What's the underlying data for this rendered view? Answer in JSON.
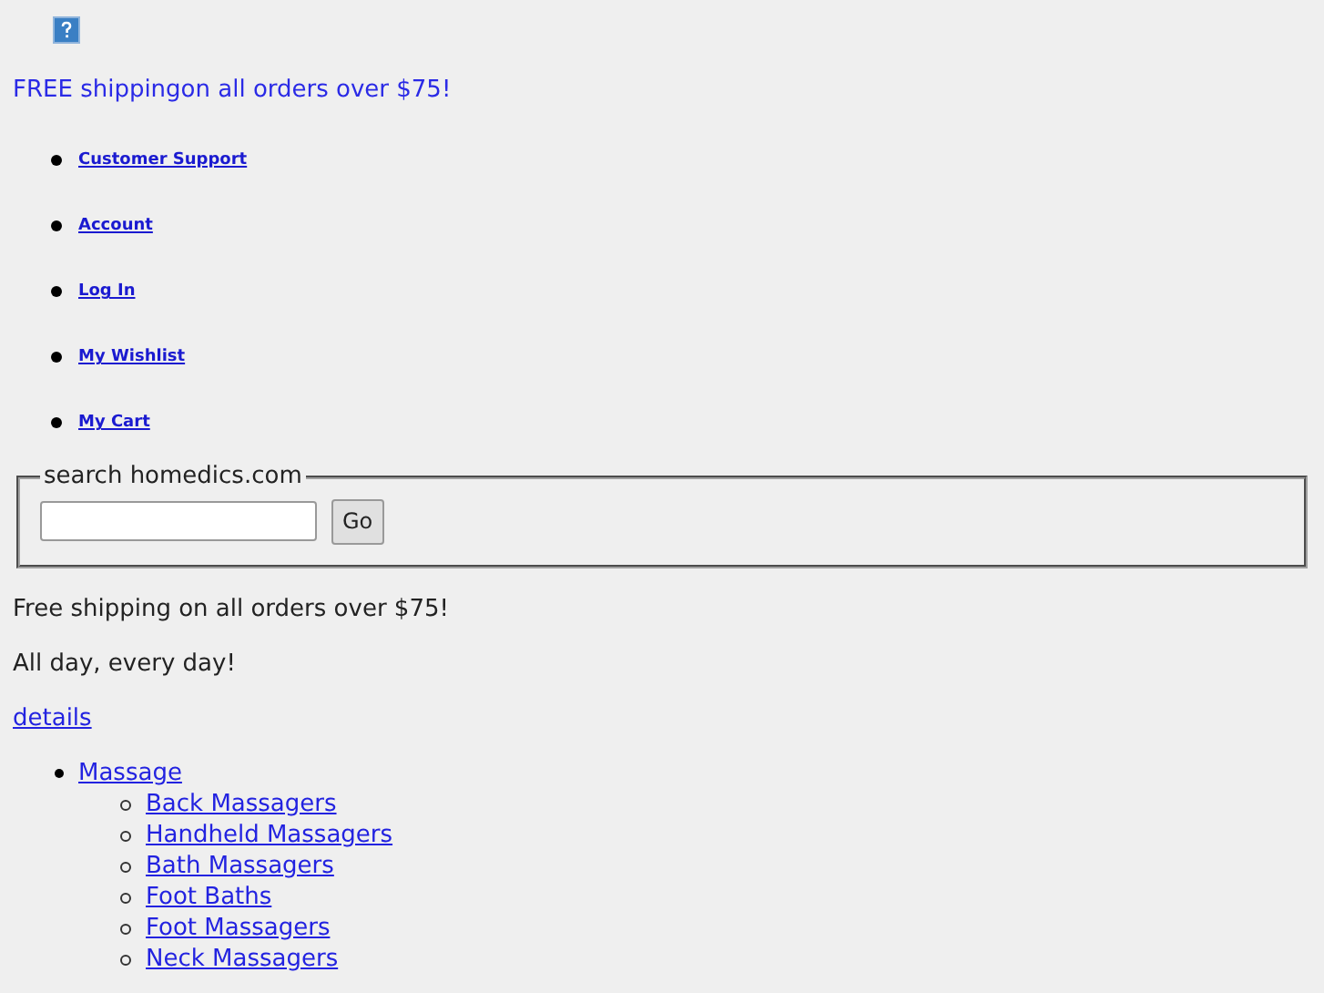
{
  "banner": "FREE shippingon all orders over $75!",
  "top_links": [
    "Customer Support",
    "Account",
    "Log In",
    "My Wishlist",
    "My Cart"
  ],
  "search": {
    "legend": "search homedics.com",
    "button": "Go"
  },
  "promo": [
    "Free shipping on all orders over $75!",
    "All day, every day!"
  ],
  "details_link": "details",
  "categories": [
    {
      "label": "Massage",
      "children": [
        {
          "label": "Back Massagers"
        },
        {
          "label": "Handheld Massagers"
        },
        {
          "label": "Bath Massagers"
        },
        {
          "label": "Foot Baths"
        },
        {
          "label": "Foot Massagers"
        },
        {
          "label": "Neck Massagers"
        }
      ]
    }
  ]
}
